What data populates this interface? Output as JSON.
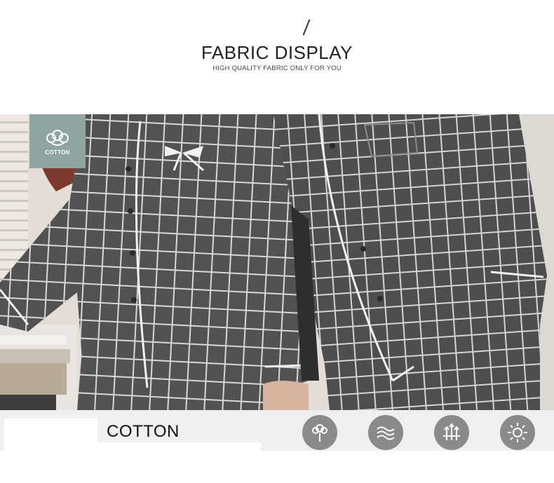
{
  "header": {
    "title": "FABRIC DISPLAY",
    "subtitle": "HIGH QUALITY FABRIC ONLY FOR YOU"
  },
  "badge": {
    "label": "COTTON",
    "icon": "cotton-flower-icon",
    "color": "#8fa5a1"
  },
  "footer": {
    "fabric_name": "COTTON",
    "features": [
      {
        "icon": "cotton-plant-icon"
      },
      {
        "icon": "water-waves-icon"
      },
      {
        "icon": "breathable-arrows-icon"
      },
      {
        "icon": "sun-icon"
      }
    ],
    "icon_color": "#8a8a8a"
  }
}
